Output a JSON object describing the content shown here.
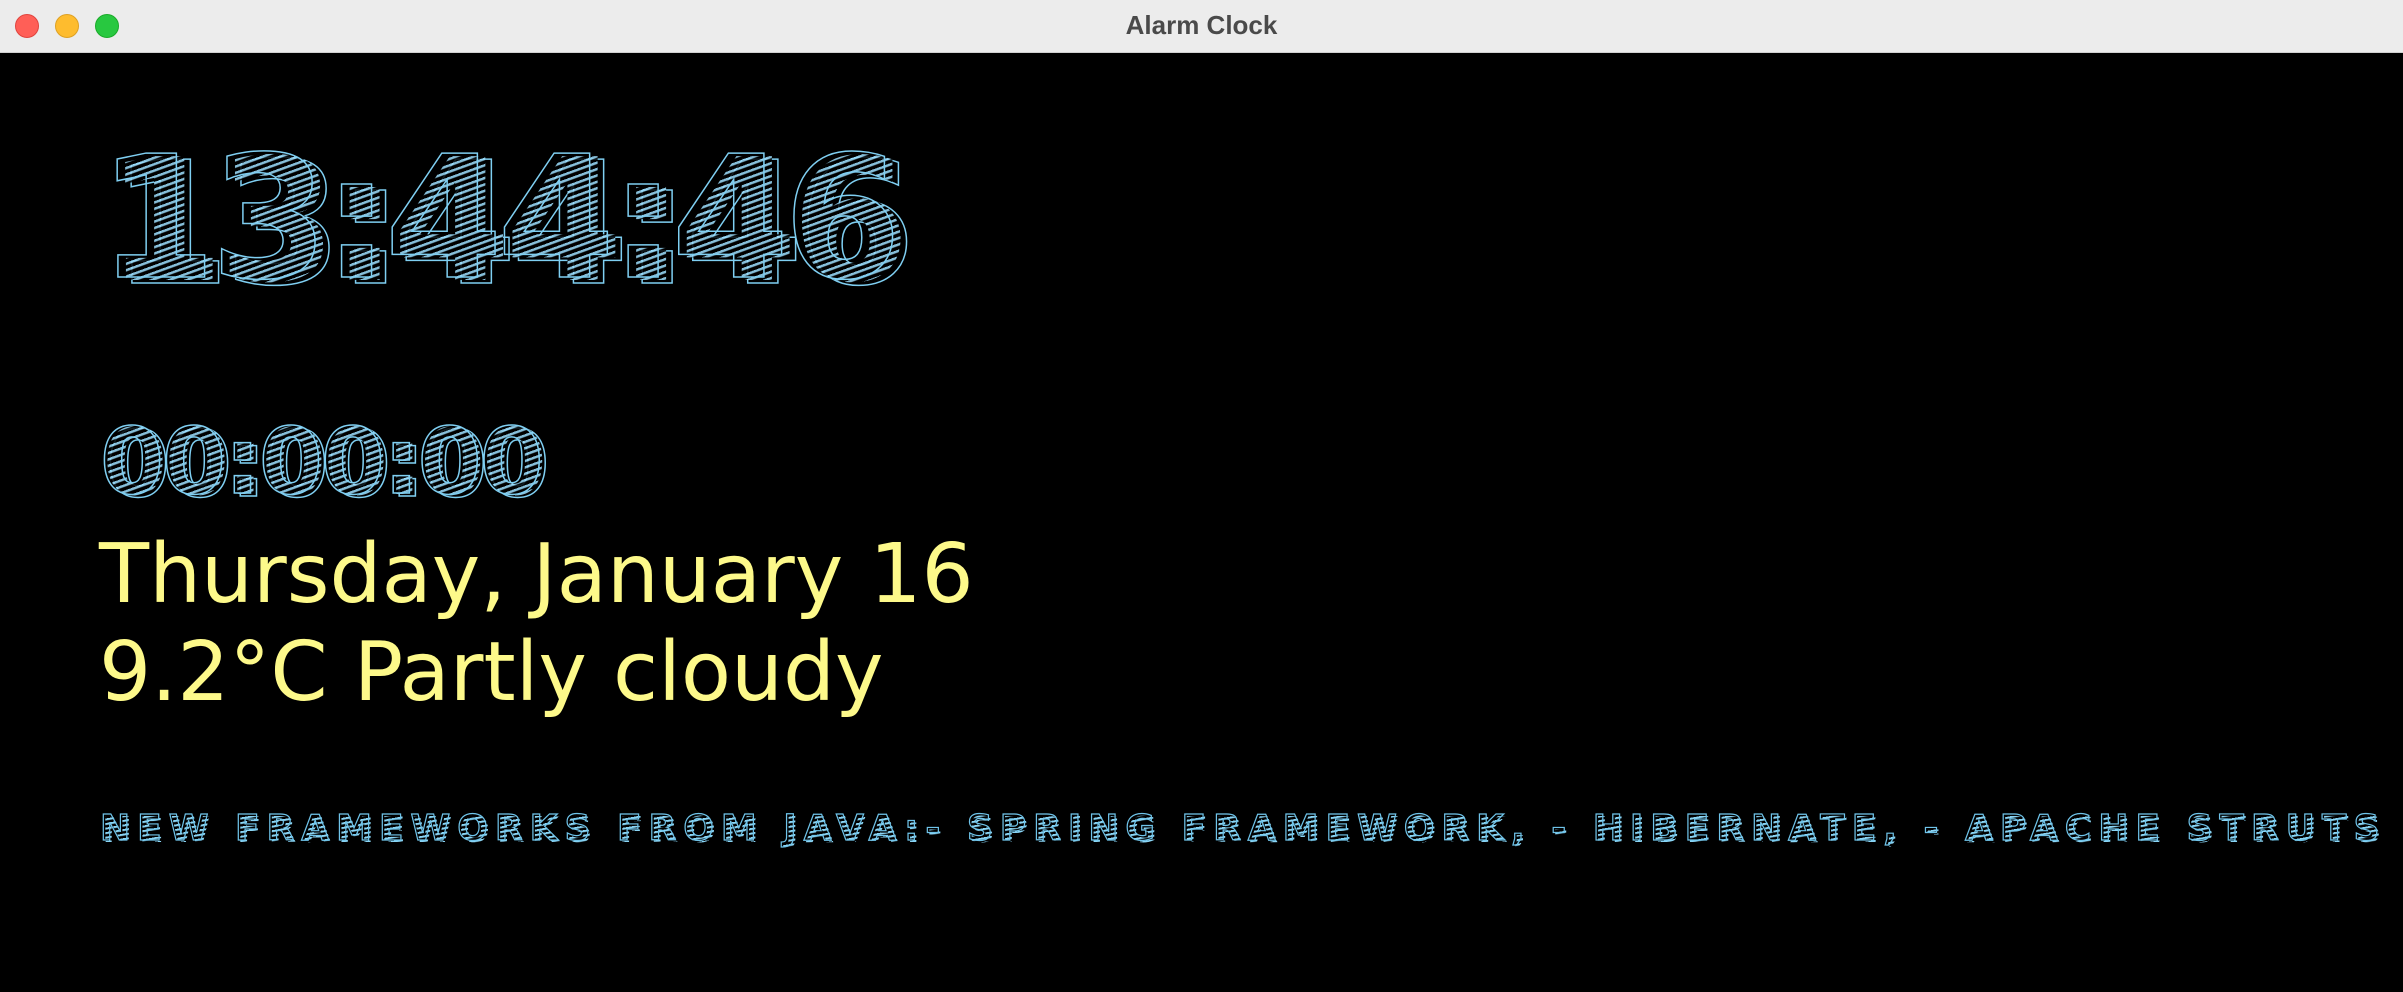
{
  "window": {
    "title": "Alarm Clock"
  },
  "clock": {
    "time": "13:44:46",
    "alarm_time": "00:00:00"
  },
  "info": {
    "date": "Thursday, January 16",
    "weather": "9.2°C Partly cloudy"
  },
  "ticker": {
    "text": "NEW FRAMEWORKS FROM JAVA:- SPRING FRAMEWORK, - HIBERNATE, - APACHE STRUTS"
  },
  "colors": {
    "background": "#000000",
    "digit_outline": "#8fd8f8",
    "info_text": "#fdf98a",
    "titlebar": "#ececec"
  }
}
